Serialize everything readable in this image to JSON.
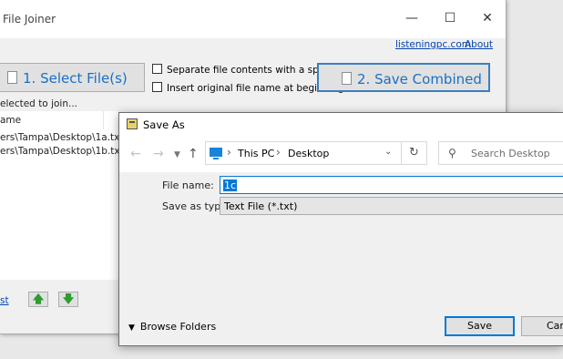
{
  "file_joiner": {
    "title": "File Joiner",
    "links": {
      "site": "listeningpc.com",
      "about": "About"
    },
    "select_button": "1. Select File(s)",
    "save_button": "2. Save Combined",
    "options": [
      {
        "label": "Separate file contents with a space",
        "checked": false
      },
      {
        "label": "Insert original file name at beginning",
        "checked": false
      }
    ],
    "status_text": "elected to join...",
    "list_header": "ame",
    "files": [
      "ers\\Tampa\\Desktop\\1a.txt",
      "ers\\Tampa\\Desktop\\1b.txt"
    ],
    "footer_link": "st",
    "move_up_icon": "arrow-up-green",
    "move_down_icon": "arrow-down-green"
  },
  "save_as": {
    "title": "Save As",
    "breadcrumb": [
      "This PC",
      "Desktop"
    ],
    "search_placeholder": "Search Desktop",
    "file_name_label": "File name:",
    "file_name_value": "1c",
    "save_type_label": "Save as type:",
    "save_type_value": "Text File (*.txt)",
    "browse_folders": "Browse Folders",
    "save_button": "Save",
    "cancel_button": "Can"
  }
}
